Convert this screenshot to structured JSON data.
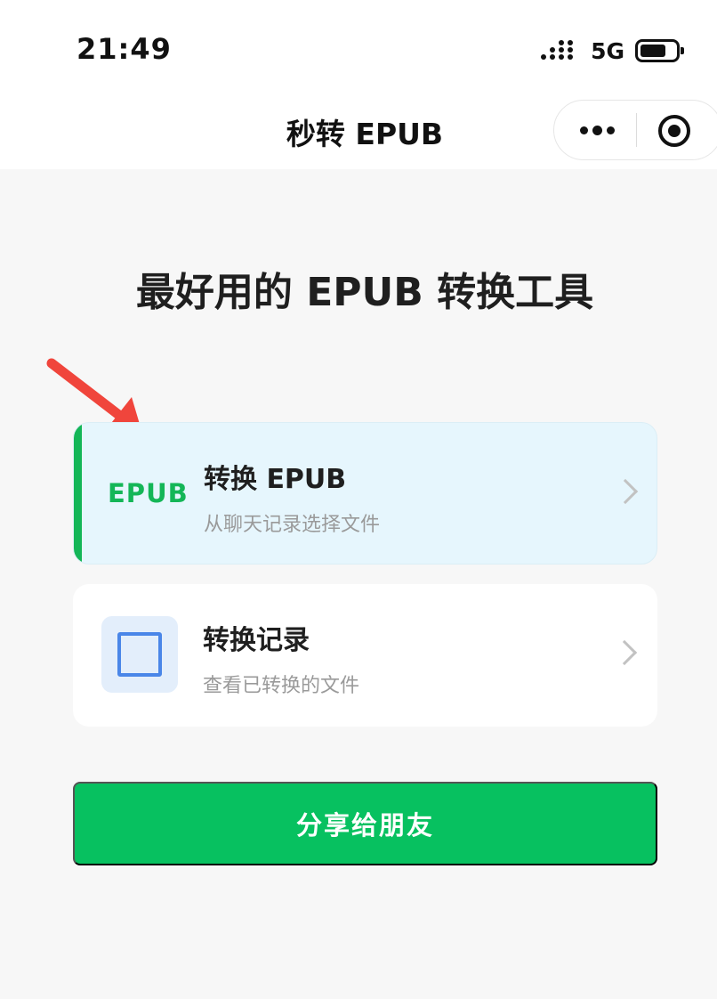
{
  "status_bar": {
    "time": "21:49",
    "network": "5G",
    "battery_level": 0.64
  },
  "nav": {
    "title": "秒转 EPUB"
  },
  "headline": "最好用的 EPUB 转换工具",
  "cards": [
    {
      "logo": "EPUB",
      "title": "转换 EPUB",
      "subtitle": "从聊天记录选择文件"
    },
    {
      "title": "转换记录",
      "subtitle": "查看已转换的文件"
    }
  ],
  "share_button": {
    "label": "分享给朋友"
  },
  "colors": {
    "accent_green": "#07c160",
    "card_highlight": "#e6f6fd",
    "arrow_red": "#f0453c"
  }
}
